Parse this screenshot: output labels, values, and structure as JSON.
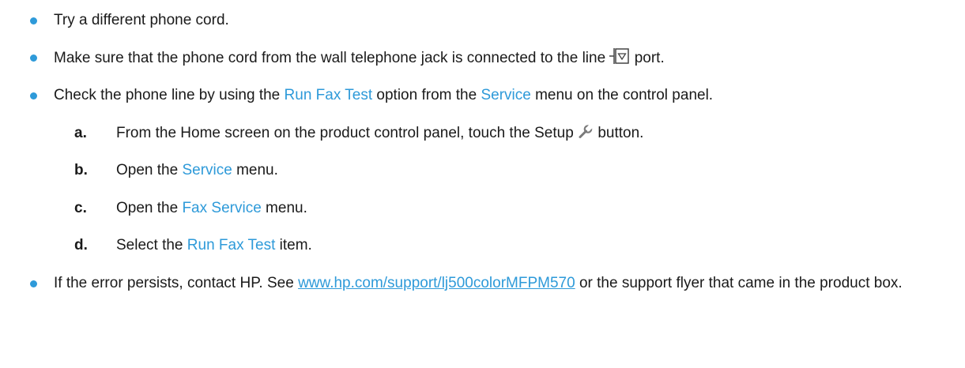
{
  "bullets": {
    "cord": "Try a different phone cord.",
    "jack_before": "Make sure that the phone cord from the wall telephone jack is connected to the line",
    "jack_after": "port.",
    "check_1": "Check the phone line by using the",
    "check_kw1": "Run Fax Test",
    "check_2": "option from the",
    "check_kw2": "Service",
    "check_3": "menu on the control panel.",
    "error_1": "If the error persists, contact HP. See",
    "error_link": "www.hp.com/support/lj500colorMFPM570",
    "error_2": "or the support flyer that came in the product box."
  },
  "steps": {
    "a_letter": "a.",
    "a_1": "From the Home screen on the product control panel, touch the Setup",
    "a_2": "button.",
    "b_letter": "b.",
    "b_1": "Open the",
    "b_kw": "Service",
    "b_2": "menu.",
    "c_letter": "c.",
    "c_1": "Open the",
    "c_kw": "Fax Service",
    "c_2": "menu.",
    "d_letter": "d.",
    "d_1": "Select the",
    "d_kw": "Run Fax Test",
    "d_2": "item."
  },
  "colors": {
    "accent": "#2e9ad9",
    "text": "#1a1a1a"
  },
  "icons": {
    "line_port": "fax-line-port-icon",
    "setup": "wrench-icon"
  }
}
